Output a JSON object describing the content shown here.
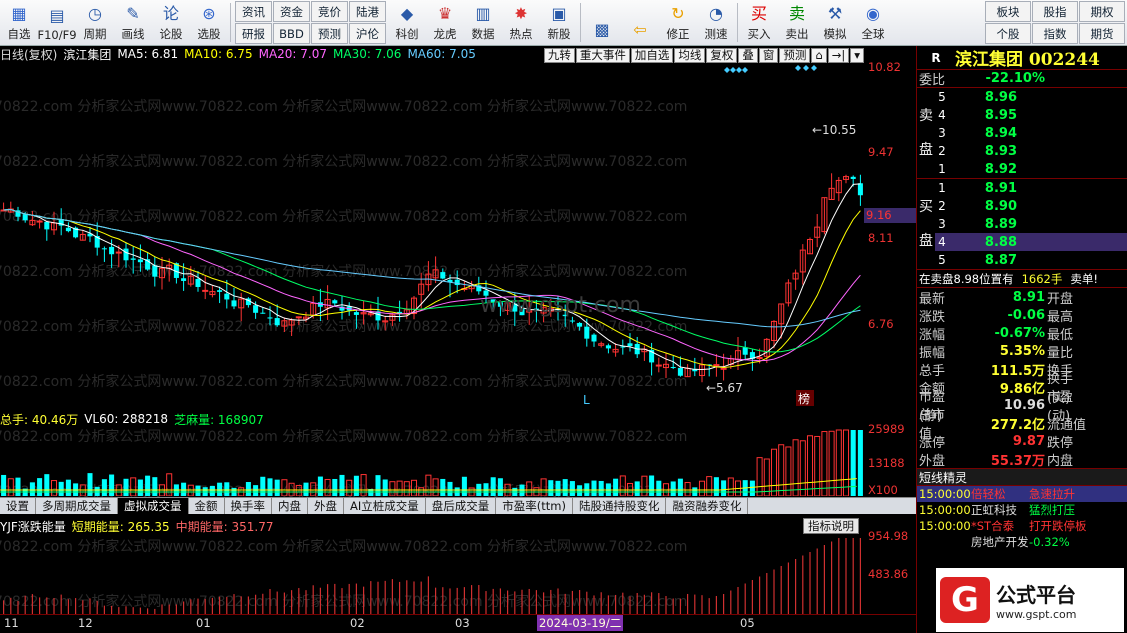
{
  "toolbar": {
    "main": [
      {
        "label": "自选",
        "icon": "watchlist-icon"
      },
      {
        "label": "F10/F9",
        "icon": "f10-icon"
      },
      {
        "label": "周期",
        "icon": "period-icon"
      },
      {
        "label": "画线",
        "icon": "drawline-icon"
      },
      {
        "label": "论股",
        "icon": "discuss-icon"
      },
      {
        "label": "选股",
        "icon": "screener-icon"
      }
    ],
    "grid": [
      "资讯",
      "资金",
      "竞价",
      "陆港",
      "研报",
      "BBD",
      "预测",
      "沪伦"
    ],
    "main2": [
      {
        "label": "科创",
        "icon": "star-market-icon"
      },
      {
        "label": "龙虎",
        "icon": "dragon-tiger-icon"
      },
      {
        "label": "数据",
        "icon": "data-icon"
      },
      {
        "label": "热点",
        "icon": "hot-icon"
      },
      {
        "label": "新股",
        "icon": "ipo-icon"
      }
    ],
    "main3": [
      {
        "label": "",
        "icon": "tiles-icon"
      },
      {
        "label": "",
        "icon": "arrow-left-icon"
      },
      {
        "label": "修正",
        "icon": "fix-icon"
      },
      {
        "label": "测速",
        "icon": "speedtest-icon"
      }
    ],
    "trade": [
      {
        "label": "买入",
        "icon": "buy-icon"
      },
      {
        "label": "卖出",
        "icon": "sell-icon"
      },
      {
        "label": "模拟",
        "icon": "simulate-icon"
      },
      {
        "label": "全球",
        "icon": "globe-icon"
      }
    ],
    "right_grid": [
      "板块",
      "股指",
      "期权",
      "个股",
      "指数",
      "期货"
    ]
  },
  "main_chart": {
    "period": "日线(复权)",
    "stock": "滨江集团",
    "ma": [
      {
        "label": "MA5: 6.81",
        "color": "#ffffff"
      },
      {
        "label": "MA10: 6.75",
        "color": "#ffff00"
      },
      {
        "label": "MA20: 7.07",
        "color": "#ff66ff"
      },
      {
        "label": "MA30: 7.06",
        "color": "#00ff66"
      },
      {
        "label": "MA60: 7.05",
        "color": "#66ccff"
      }
    ],
    "tools": [
      "九转",
      "重大事件",
      "加自选",
      "均线",
      "复权",
      "叠",
      "窗",
      "预测",
      "",
      "",
      ""
    ],
    "y_labels": [
      "10.82",
      "9.47",
      "9.16",
      "8.11",
      "6.76"
    ],
    "annotations": {
      "high": "10.55",
      "low": "5.67",
      "marker_L": "L",
      "marker_bang": "榜"
    },
    "watermark": "www.gspt.com"
  },
  "volume": {
    "label": "总手: 40.46万",
    "vl60": "VL60: 288218",
    "zhima": "芝麻量: 168907",
    "y_labels": [
      "25989",
      "13188",
      "X100"
    ]
  },
  "tabs": [
    "设置",
    "多周期成交量",
    "虚拟成交量",
    "金额",
    "换手率",
    "内盘",
    "外盘",
    "AI立桩成交量",
    "盘后成交量",
    "市盈率(ttm)",
    "陆股通持股变化",
    "融资融券变化"
  ],
  "active_tab": "虚拟成交量",
  "indicator": {
    "name": "YJF涨跌能量",
    "short": "短期能量: 265.35",
    "mid": "中期能量: 351.77",
    "help": "指标说明",
    "y_labels": [
      "954.98",
      "483.86"
    ]
  },
  "dates": [
    "11",
    "12",
    "01",
    "02",
    "03",
    "05"
  ],
  "hover_date": "2024-03-19/二",
  "panel": {
    "code_prefix": "R",
    "name": "滨江集团 002244",
    "weibi_label": "委比",
    "weibi": "-22.10%",
    "sell_side": "卖盘",
    "buy_side": "买盘",
    "asks": [
      {
        "lv": "5",
        "price": "8.96"
      },
      {
        "lv": "4",
        "price": "8.95"
      },
      {
        "lv": "3",
        "price": "8.94"
      },
      {
        "lv": "2",
        "price": "8.93"
      },
      {
        "lv": "1",
        "price": "8.92"
      }
    ],
    "bids": [
      {
        "lv": "1",
        "price": "8.91"
      },
      {
        "lv": "2",
        "price": "8.90"
      },
      {
        "lv": "3",
        "price": "8.89"
      },
      {
        "lv": "4",
        "price": "8.88"
      },
      {
        "lv": "5",
        "price": "8.87"
      }
    ],
    "sell_note": "在卖盘8.98位置有",
    "sell_qty": "1662手",
    "sell_word": "卖单!",
    "quotes": [
      {
        "l1": "最新",
        "v1": "8.91",
        "c1": "g",
        "l2": "开盘",
        "v2": "",
        "c2": "w"
      },
      {
        "l1": "涨跌",
        "v1": "-0.06",
        "c1": "g",
        "l2": "最高",
        "v2": "",
        "c2": "w"
      },
      {
        "l1": "涨幅",
        "v1": "-0.67%",
        "c1": "g",
        "l2": "最低",
        "v2": "",
        "c2": "w"
      },
      {
        "l1": "振幅",
        "v1": "5.35%",
        "c1": "y",
        "l2": "量比",
        "v2": "",
        "c2": "w"
      },
      {
        "l1": "总手",
        "v1": "111.5万",
        "c1": "y",
        "l2": "换手",
        "v2": "",
        "c2": "w"
      },
      {
        "l1": "金额",
        "v1": "9.86亿",
        "c1": "y",
        "l2": "换手(实)",
        "v2": "",
        "c2": "w"
      },
      {
        "l1": "市盈(静)",
        "v1": "10.96",
        "c1": "w",
        "l2": "市盈(动)",
        "v2": "",
        "c2": "w"
      },
      {
        "l1": "总市值",
        "v1": "277.2亿",
        "c1": "y",
        "l2": "流通值",
        "v2": "",
        "c2": "w"
      },
      {
        "l1": "涨停",
        "v1": "9.87",
        "c1": "rr",
        "l2": "跌停",
        "v2": "",
        "c2": "w"
      },
      {
        "l1": "外盘",
        "v1": "55.37万",
        "c1": "rr",
        "l2": "内盘",
        "v2": "",
        "c2": "w"
      }
    ],
    "sprite_title": "短线精灵",
    "sprites": [
      {
        "t": "15:00:00",
        "n": "倍轻松",
        "nc": "rr",
        "e": "急速拉升",
        "ec": "rr",
        "hl": true
      },
      {
        "t": "15:00:00",
        "n": "正虹科技",
        "nc": "w",
        "e": "猛烈打压",
        "ec": "g",
        "hl": false
      },
      {
        "t": "15:00:00",
        "n": "*ST合泰",
        "nc": "rr",
        "e": "打开跌停板",
        "ec": "rr",
        "hl": false
      },
      {
        "t": "",
        "n": "房地产开发",
        "nc": "w",
        "e": "-0.32%",
        "ec": "g",
        "hl": false
      }
    ]
  },
  "brand": {
    "logo": "G",
    "name": "公式平台",
    "url": "www.gspt.com"
  },
  "colors": {
    "up": "#ff3333",
    "down": "#00ffff",
    "bg": "#000000"
  }
}
